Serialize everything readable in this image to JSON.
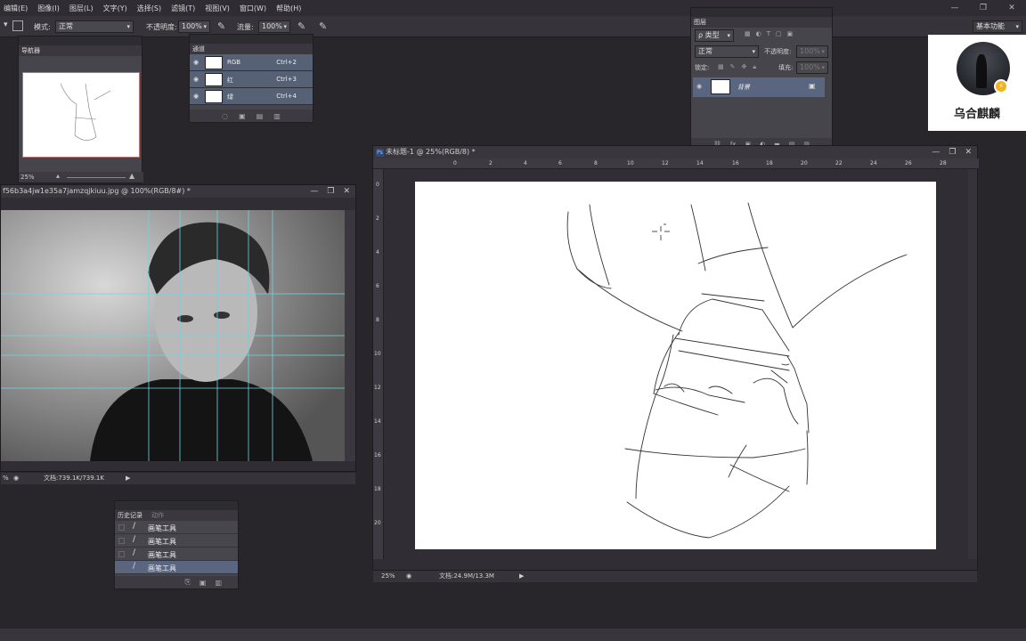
{
  "menubar": {
    "items": [
      "编辑(E)",
      "图像(I)",
      "图层(L)",
      "文字(Y)",
      "选择(S)",
      "滤镜(T)",
      "视图(V)",
      "窗口(W)",
      "帮助(H)"
    ]
  },
  "optionsbar": {
    "mode_label": "模式:",
    "mode_value": "正常",
    "opacity_label": "不透明度:",
    "opacity_value": "100%",
    "flow_label": "流量:",
    "flow_value": "100%",
    "workspace": "基本功能"
  },
  "navigator": {
    "tab": "导航器",
    "zoom": "25%"
  },
  "channels": {
    "tab": "通道",
    "rows": [
      {
        "name": "RGB",
        "shortcut": "Ctrl+2"
      },
      {
        "name": "红",
        "shortcut": "Ctrl+3"
      },
      {
        "name": "绿",
        "shortcut": "Ctrl+4"
      }
    ]
  },
  "layers": {
    "tab": "图层",
    "kind_label": "ρ 类型",
    "blend": "正常",
    "opacity_label": "不透明度:",
    "opacity_value": "100%",
    "lock_label": "锁定:",
    "fill_label": "填充:",
    "fill_value": "100%",
    "layer_name": "背景"
  },
  "reference_doc": {
    "title": "f56b3a4jw1e35a7jamzqjkiuu.jpg @ 100%(RGB/8#) *",
    "zoom": "%",
    "doc_info": "文档:739.1K/739.1K"
  },
  "canvas_doc": {
    "title": "未标题-1 @ 25%(RGB/8) *",
    "zoom": "25%",
    "doc_info": "文档:24.9M/13.3M",
    "ruler_top": [
      "0",
      "2",
      "4",
      "6",
      "8",
      "10",
      "12",
      "14",
      "16",
      "18",
      "20",
      "22",
      "24",
      "26",
      "28"
    ],
    "ruler_left": [
      "0",
      "2",
      "4",
      "6",
      "8",
      "10",
      "12",
      "14",
      "16",
      "18",
      "20"
    ]
  },
  "history": {
    "tab_active": "历史记录",
    "tab_other": "动作",
    "rows": [
      "画笔工具",
      "画笔工具",
      "画笔工具",
      "画笔工具"
    ]
  },
  "profile": {
    "name": "乌合麒麟"
  }
}
